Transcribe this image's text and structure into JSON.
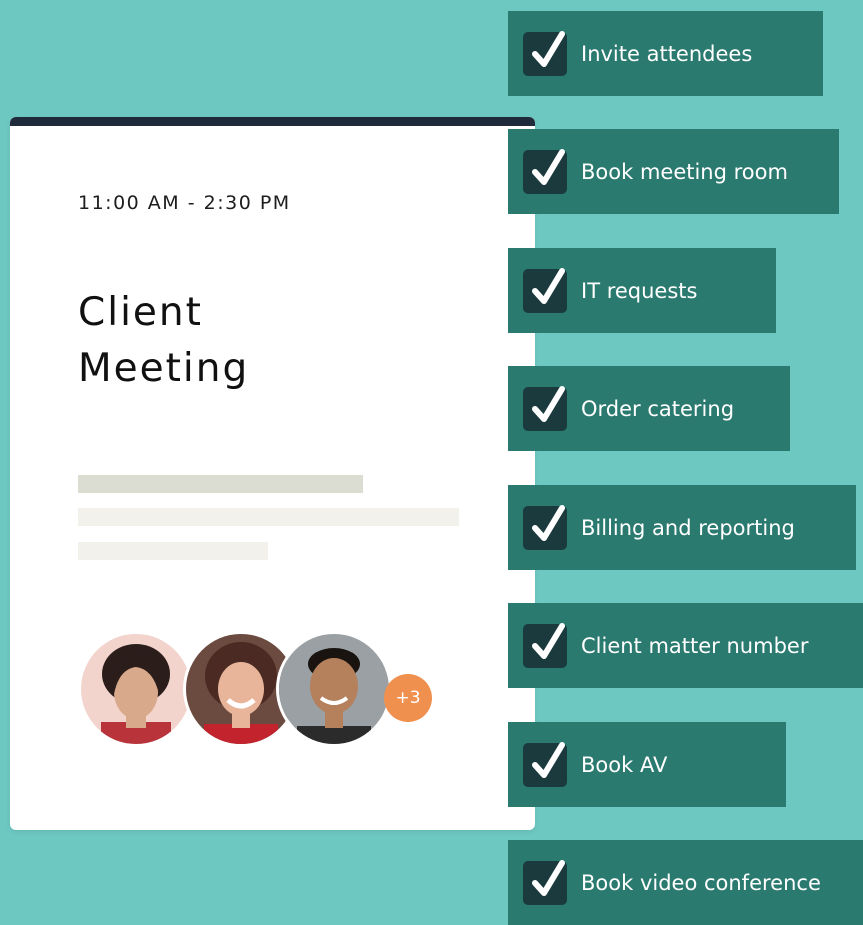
{
  "event": {
    "time": "11:00 AM - 2:30 PM",
    "title_line1": "Client",
    "title_line2": "Meeting",
    "extra_attendees": "+3"
  },
  "tasks": [
    {
      "label": "Invite attendees",
      "checked": true
    },
    {
      "label": "Book meeting room",
      "checked": true
    },
    {
      "label": "IT requests",
      "checked": true
    },
    {
      "label": "Order catering",
      "checked": true
    },
    {
      "label": "Billing and reporting",
      "checked": true
    },
    {
      "label": "Client matter number",
      "checked": true
    },
    {
      "label": "Book AV",
      "checked": true
    },
    {
      "label": "Book video conference",
      "checked": true
    }
  ],
  "colors": {
    "background": "#6ec8c2",
    "task_bg": "#2b7a70",
    "checkbox_bg": "#1a3a3d",
    "badge": "#f0904f",
    "card_topbar": "#1f2a3a"
  }
}
